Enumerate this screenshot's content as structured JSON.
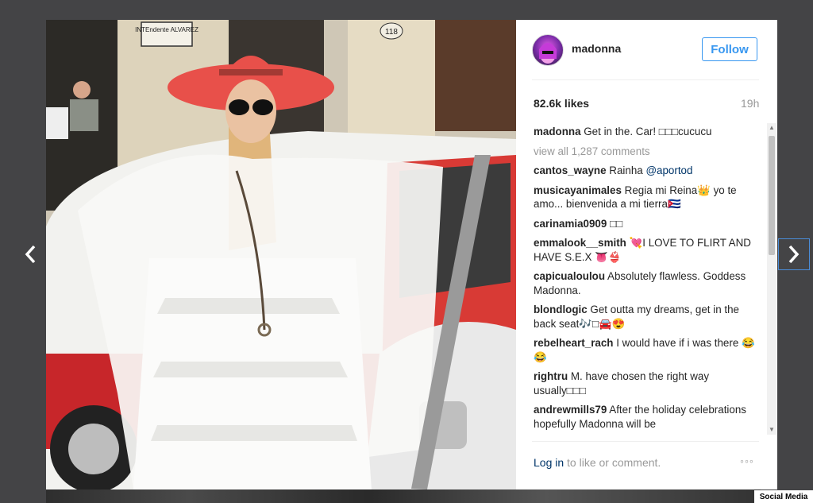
{
  "post": {
    "username": "madonna",
    "follow_label": "Follow",
    "likes": "82.6k likes",
    "time": "19h",
    "caption_user": "madonna",
    "caption_text": "Get in the. Car! □□□cucucu",
    "view_all": "view all 1,287 comments"
  },
  "comments": [
    {
      "user": "cantos_wayne",
      "text": "Rainha ",
      "mention": "@aportod"
    },
    {
      "user": "musicayanimales",
      "text": "Regia mi Reina👑 yo te amo... bienvenida a mi tierra🇨🇺"
    },
    {
      "user": "carinamia0909",
      "text": "□□"
    },
    {
      "user": "emmalook__smith",
      "text": "💘I LOVE TO FLIRT AND HAVE S.E.X 👅👙"
    },
    {
      "user": "capicualoulou",
      "text": "Absolutely flawless. Goddess Madonna."
    },
    {
      "user": "blondlogic",
      "text": "Get outta my dreams, get in the back seat🎶□🚘😍"
    },
    {
      "user": "rebelheart_rach",
      "text": "I would have if i was there 😂😂"
    },
    {
      "user": "rightru",
      "text": "M. have chosen the right way usually□□□"
    },
    {
      "user": "andrewmills79",
      "text": "After the holiday celebrations hopefully Madonna will be"
    }
  ],
  "footer": {
    "login_link": "Log in",
    "login_rest": " to like or comment.",
    "more": "◦◦◦"
  },
  "photo": {
    "sign1": "INTEndente ALVAREZ",
    "sign2": "118"
  },
  "watermark": "Social Media",
  "icons": {
    "prev": "chevron-left-icon",
    "next": "chevron-right-icon"
  },
  "colors": {
    "accent": "#3897f0",
    "link": "#003569",
    "hat": "#e8504a"
  }
}
